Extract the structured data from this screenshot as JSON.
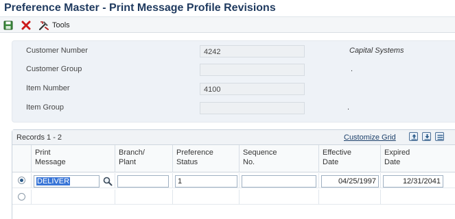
{
  "window": {
    "title": "Preference Master - Print Message Profile Revisions"
  },
  "toolbar": {
    "save_icon": "save-icon",
    "cancel_icon": "close-icon",
    "tools_label": "Tools",
    "tools_icon": "tools-icon"
  },
  "header": {
    "fields": [
      {
        "label": "Customer Number",
        "value": "4242",
        "description": "Capital Systems"
      },
      {
        "label": "Customer Group",
        "value": "",
        "description": "."
      },
      {
        "label": "Item Number",
        "value": "4100",
        "description": ""
      },
      {
        "label": "Item Group",
        "value": "",
        "description": "."
      }
    ]
  },
  "grid": {
    "records_label": "Records 1 - 2",
    "customize_label": "Customize Grid",
    "columns": [
      "Print\nMessage",
      "Branch/\nPlant",
      "Preference\nStatus",
      "Sequence\nNo.",
      "Effective\nDate",
      "Expired\nDate"
    ],
    "rows": [
      {
        "selected": true,
        "print_message": "DELIVER",
        "branch_plant": "",
        "preference_status": "1",
        "sequence_no": "",
        "effective_date": "04/25/1997",
        "expired_date": "12/31/2041"
      },
      {
        "selected": false,
        "print_message": "",
        "branch_plant": "",
        "preference_status": "",
        "sequence_no": "",
        "effective_date": "",
        "expired_date": ""
      }
    ]
  }
}
